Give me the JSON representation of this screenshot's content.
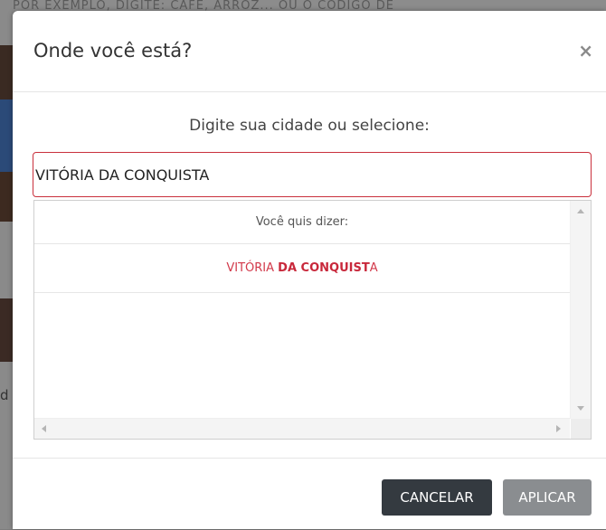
{
  "background": {
    "top_text": "POR EXEMPLO, DIGITE: CAFÉ, ARROZ... OU O CÓDIGO DE",
    "left_char": "d",
    "strip_colors": [
      "#3a2a22",
      "#2b4a78",
      "#3d2a20",
      "#3b2a24",
      "#cfcfcf"
    ]
  },
  "modal": {
    "title": "Onde você está?",
    "close_label": "×",
    "prompt": "Digite sua cidade ou selecione:",
    "input_value": "VITÓRIA DA CONQUISTA",
    "suggestions": {
      "header": "Você quis dizer:",
      "items": [
        {
          "prefix": "VITÓRIA ",
          "match": "DA CONQUIST",
          "suffix": "A"
        }
      ]
    },
    "buttons": {
      "cancel": "CANCELAR",
      "apply": "APLICAR"
    }
  },
  "colors": {
    "accent": "#c8283b",
    "cancel_bg": "#343a40",
    "apply_bg": "#8a8d90"
  }
}
